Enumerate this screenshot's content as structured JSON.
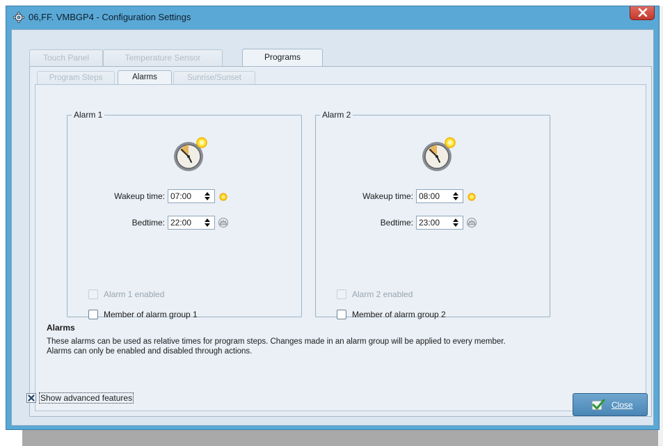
{
  "window": {
    "title": "06,FF. VMBGP4 - Configuration Settings"
  },
  "tabs": [
    {
      "label": "Touch Panel",
      "active": false
    },
    {
      "label": "Temperature Sensor",
      "active": false
    },
    {
      "label": "Programs",
      "active": true
    }
  ],
  "sub_tabs": [
    {
      "label": "Program Steps",
      "active": false
    },
    {
      "label": "Alarms",
      "active": true
    },
    {
      "label": "Sunrise/Sunset",
      "active": false
    }
  ],
  "alarms": [
    {
      "legend": "Alarm 1",
      "wakeup_label": "Wakeup time:",
      "wakeup_value": "07:00",
      "bedtime_label": "Bedtime:",
      "bedtime_value": "22:00",
      "enabled_label": "Alarm 1 enabled",
      "enabled_checked": false,
      "group_label": "Member of alarm group 1",
      "group_checked": false
    },
    {
      "legend": "Alarm 2",
      "wakeup_label": "Wakeup time:",
      "wakeup_value": "08:00",
      "bedtime_label": "Bedtime:",
      "bedtime_value": "23:00",
      "enabled_label": "Alarm 2 enabled",
      "enabled_checked": false,
      "group_label": "Member of alarm group 2",
      "group_checked": false
    }
  ],
  "info": {
    "title": "Alarms",
    "body": "These alarms can be used as relative times for program steps. Changes made in an alarm group will be applied to every member. Alarms can only be enabled and disabled through actions."
  },
  "footer": {
    "advanced_label": "Show advanced features",
    "advanced_checked": true,
    "close_label": "Close"
  },
  "colors": {
    "title_bar": "#5aa8d6",
    "close_x": "#c2392c",
    "button": "#4a86b6"
  }
}
